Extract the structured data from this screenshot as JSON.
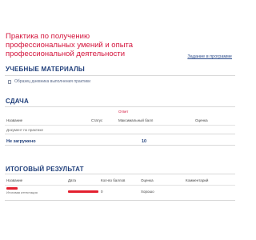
{
  "header": {
    "title": "Практика по получению профессиональных умений и опыта профессиональной деятельности",
    "link": "Задание в программе"
  },
  "materials": {
    "title": "УЧЕБНЫЕ МАТЕРИАЛЫ",
    "item": "Образец дневника выполнения практики"
  },
  "submit": {
    "title": "СДАЧА",
    "link": "Ответ",
    "columns": [
      "Название",
      "Статус",
      "Максимальный балл",
      "Оценка"
    ],
    "row_name": "Документ по практике",
    "row_value": "Не загружено",
    "row_extra": "10"
  },
  "result": {
    "title": "ИТОГОВЫЙ РЕЗУЛЬТАТ",
    "columns": [
      "Название",
      "Дата",
      "Кол-во баллов",
      "Оценка",
      "Комментарий"
    ],
    "row_sub": "Итоговая аттестация",
    "row_points": "0",
    "row_grade": "Хорошо"
  },
  "colors": {
    "accent": "#d4143c",
    "heading": "#1f3e7a",
    "redaction": "#e3202f"
  }
}
